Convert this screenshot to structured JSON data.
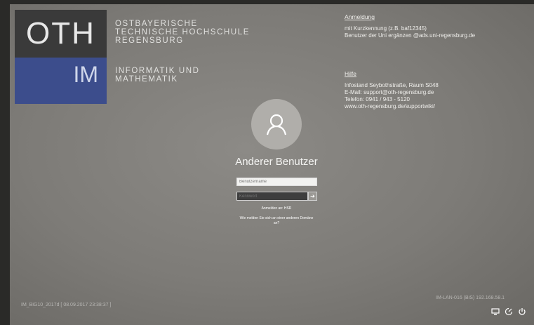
{
  "logo": {
    "top": "OTH",
    "bottom": "IM"
  },
  "institution": {
    "line1": "OSTBAYERISCHE",
    "line2": "TECHNISCHE HOCHSCHULE",
    "line3": "REGENSBURG"
  },
  "faculty": {
    "line1": "INFORMATIK UND",
    "line2": "MATHEMATIK"
  },
  "info_login": {
    "heading": "Anmeldung",
    "line1": "mit Kurzkennung (z.B. baf12345)",
    "line2": "Benutzer der Uni ergänzen @ads.uni-regensburg.de"
  },
  "info_help": {
    "heading": "Hilfe",
    "line1": "Infostand Seybothstraße, Raum S048",
    "line2": "E-Mail: support@oth-regensburg.de",
    "line3": "Telefon: 0941 / 943 - 5120",
    "line4": "www.oth-regensburg.de/supportwiki/"
  },
  "login": {
    "user_label": "Anderer Benutzer",
    "username_placeholder": "Benutzername",
    "password_placeholder": "Kennwort",
    "sign_in_to": "Anmelden an: HSR",
    "other_domain": "Wie melden Sie sich an einer anderen Domäne an?"
  },
  "footer": {
    "machine": "IM_BiG10_2017d [ 08.09.2017 23:38:37 ]",
    "network": "IM-LAN-016 (BiS) 192.168.58.1"
  },
  "icons": [
    "network-icon",
    "ease-of-access-icon",
    "power-icon"
  ]
}
